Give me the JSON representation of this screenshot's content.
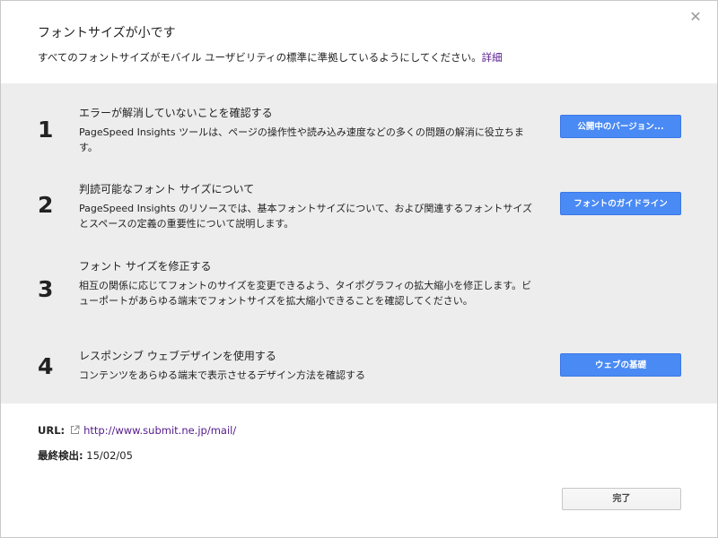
{
  "dialog": {
    "close_glyph": "✕",
    "title": "フォントサイズが小です",
    "subtitle": "すべてのフォントサイズがモバイル ユーザビリティの標準に準拠しているようにしてください。",
    "details_link": "詳細"
  },
  "steps": [
    {
      "number": "1",
      "title": "エラーが解消していないことを確認する",
      "description": "PageSpeed Insights ツールは、ページの操作性や読み込み速度などの多くの問題の解消に役立ちます。",
      "button": "公開中のバージョン..."
    },
    {
      "number": "2",
      "title": "判読可能なフォント サイズについて",
      "description": "PageSpeed Insights のリソースでは、基本フォントサイズについて、および関連するフォントサイズとスペースの定義の重要性について説明します。",
      "button": "フォントのガイドライン"
    },
    {
      "number": "3",
      "title": "フォント サイズを修正する",
      "description": "相互の関係に応じてフォントのサイズを変更できるよう、タイポグラフィの拡大縮小を修正します。ビューポートがあらゆる端末でフォントサイズを拡大縮小できることを確認してください。",
      "button": ""
    },
    {
      "number": "4",
      "title": "レスポンシブ ウェブデザインを使用する",
      "description": "コンテンツをあらゆる端末で表示させるデザイン方法を確認する",
      "button": "ウェブの基礎"
    }
  ],
  "meta": {
    "url_label": "URL:",
    "url": "http://www.submit.ne.jp/mail/",
    "detected_label": "最終検出:",
    "detected_date": "15/02/05"
  },
  "footer": {
    "done_label": "完了"
  },
  "colors": {
    "primary_button": "#4a8af4",
    "panel_background": "#ededed",
    "link": "#551a8b"
  }
}
